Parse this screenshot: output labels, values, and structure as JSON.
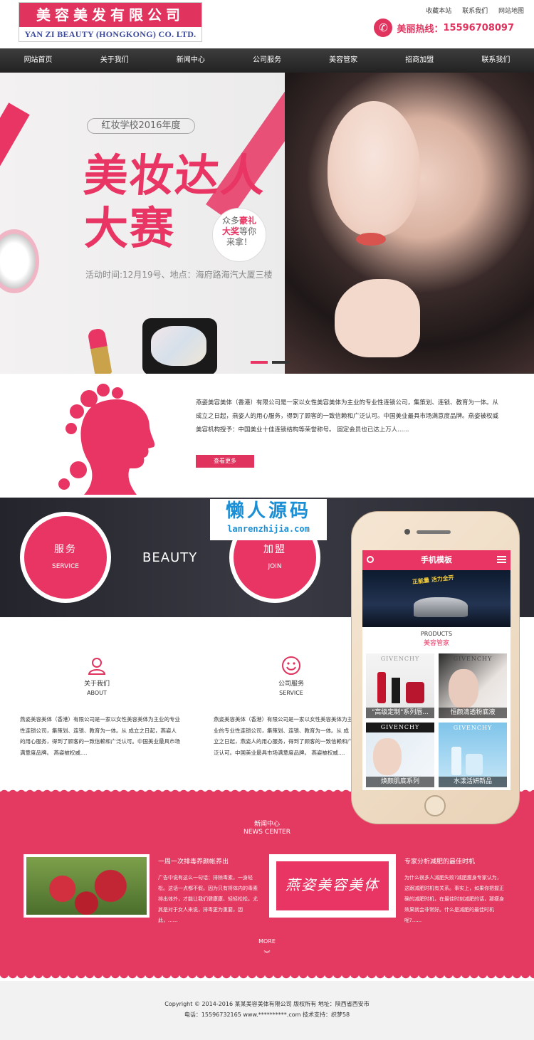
{
  "header": {
    "logo_cn": "美容美发有限公司",
    "logo_en": "YAN ZI BEAUTY (HONGKONG) CO. LTD.",
    "top_links": [
      "收藏本站",
      "联系我们",
      "网站地图"
    ],
    "hotline_label": "美丽热线：",
    "hotline_number": "15596708097"
  },
  "nav": {
    "items": [
      "网站首页",
      "关于我们",
      "新闻中心",
      "公司服务",
      "美容管家",
      "招商加盟",
      "联系我们"
    ]
  },
  "banner": {
    "tag": "红妆学校2016年度",
    "title_line1": "美妆达人",
    "title_line2": "大赛",
    "gift_line1": "众多",
    "gift_bold1": "豪礼",
    "gift_line2": "大奖",
    "gift_line2b": "等你",
    "gift_line3": "来拿！",
    "time": "活动时间:12月19号、地点：海府路海汽大厦三楼"
  },
  "intro": {
    "text": "燕姿美容美体（香港）有限公司是一家以女性美容美体为主业的专业性连锁公司，集策划、连锁、教育为一体。从成立之日起，燕姿人的用心服务，得到了顾客的一致信赖和广泛认可。中国美业最具市场满意度品牌。燕姿被权威美容机构授予：中国美业十佳连锁结构等荣誉称号。 固定会员也已达上万人......",
    "more_label": "查看更多"
  },
  "band": {
    "service_cn": "服务",
    "service_en": "SERVICE",
    "beauty": "BEAUTY",
    "join_cn": "加盟",
    "join_en": "JOIN"
  },
  "watermark": {
    "cn": "懒人源码",
    "url": "lanrenzhijia.com"
  },
  "about": {
    "title_cn": "关于我们",
    "title_en": "ABOUT",
    "text": "燕姿美容美体（香港）有限公司是一家以女性美容美体为主业的专业性连锁公司，集策划、连锁、教育为一体。从 成立之日起，燕姿人的用心服务，得到了顾客的一致信赖和广泛认可。中国美业最具市场满意度品牌。 燕姿被权威...."
  },
  "service": {
    "title_cn": "公司服务",
    "title_en": "SERVICE",
    "text": "燕姿美容美体（香港）有限公司是一家以女性美容美体为主业的专业性连锁公司，集策划、连锁、教育为一体。从 成立之日起，燕姿人的用心服务，得到了顾客的一致信赖和广泛认可。中国美业最具市场满意度品牌。 燕姿被权威...."
  },
  "news": {
    "title_cn": "新闻中心",
    "title_en": "NEWS CENTER",
    "item1_title": "一周一次排毒养颜帐养出",
    "item1_text": "广告中说有这么一句话：排除毒素，一身轻松。这话一点都不假。因为只有将体内的毒素排出体外，才能让我们健康康、轻轻松松。尤其是对于女人来说，排毒更为重要，因此，......",
    "brand_text": "燕姿美容美体",
    "item2_title": "专家分析减肥的最佳时机",
    "item2_text": "为什么很多人减肥失败?减肥瘦身专家认为，这跟减肥时机有关系。事实上，如果你把握正确的减肥时机，在最佳时刻减肥的话，那瘦身效果就会非常好。什么是减肥的最佳时机呢?......",
    "more": "MORE",
    "arrow": "︾"
  },
  "footer": {
    "line1": "Copyright © 2014-2016 某某美容美体有限公司 版权所有      地址：陕西省西安市",
    "line2": "电话：15596732165          www.**********.com               技术支持：织梦58"
  },
  "mobile": {
    "header": "手机模板",
    "banner_text": "正能量 活力全开",
    "products_en": "PRODUCTS",
    "products_cn": "美容管家",
    "items": [
      {
        "brand": "GIVENCHY",
        "caption": "\"高级定制\"系列唇..."
      },
      {
        "brand": "GIVENCHY",
        "caption": "恒颜清透粉底液"
      },
      {
        "brand": "GIVENCHY",
        "caption": "焕颜肌底系列"
      },
      {
        "brand": "GIVENCHY",
        "caption": "水漾活妍新品"
      }
    ]
  },
  "colors": {
    "accent": "#e0345f",
    "nav_bg": "#2e2e2e",
    "news_bg": "#e43a61"
  }
}
